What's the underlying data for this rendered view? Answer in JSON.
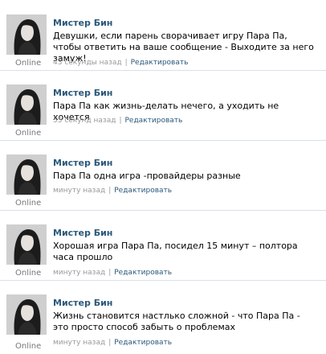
{
  "posts": [
    {
      "author": "Мистер Бин",
      "text": "Девушки, если парень сворачивает игру Пара Па, чтобы ответить на ваше сообщение - Выходите за него замуж!",
      "time": "43 секунды назад",
      "separator": "|",
      "edit_label": "Редактировать",
      "status": "Online"
    },
    {
      "author": "Мистер Бин",
      "text": "Пара Па как жизнь-делать нечего, а уходить не хочется",
      "time": "55 секунд назад",
      "separator": "|",
      "edit_label": "Редактировать",
      "status": "Online"
    },
    {
      "author": "Мистер Бин",
      "text": "Пара Па одна игра -провайдеры разные",
      "time": "минуту назад",
      "separator": "|",
      "edit_label": "Редактировать",
      "status": "Online"
    },
    {
      "author": "Мистер Бин",
      "text": "Хорошая игра Пара Па, посидел 15 минут – полтора часа прошло",
      "time": "минуту назад",
      "separator": "|",
      "edit_label": "Редактировать",
      "status": "Online"
    },
    {
      "author": "Мистер Бин",
      "text": "Жизнь становится настлько сложной - что Пара Па - это просто способ забыть о проблемах",
      "time": "минуту назад",
      "separator": "|",
      "edit_label": "Редактировать",
      "status": "Online"
    }
  ],
  "colors": {
    "link": "#2b587a",
    "meta": "#999999",
    "divider": "#dae1e8",
    "online": "#777777"
  }
}
